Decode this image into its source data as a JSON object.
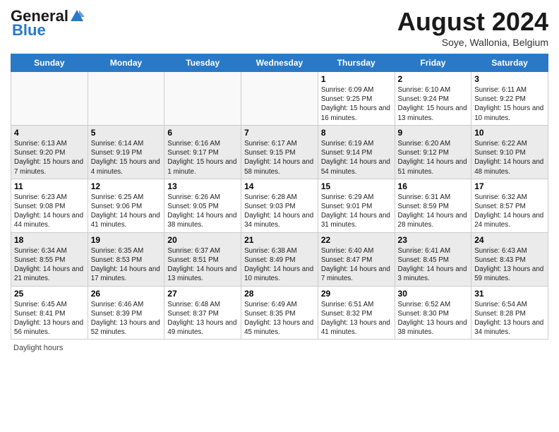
{
  "header": {
    "logo_general": "General",
    "logo_blue": "Blue",
    "month_title": "August 2024",
    "location": "Soye, Wallonia, Belgium"
  },
  "days_of_week": [
    "Sunday",
    "Monday",
    "Tuesday",
    "Wednesday",
    "Thursday",
    "Friday",
    "Saturday"
  ],
  "footer": {
    "daylight_label": "Daylight hours"
  },
  "weeks": [
    {
      "row_class": "row-odd",
      "days": [
        {
          "number": "",
          "info": ""
        },
        {
          "number": "",
          "info": ""
        },
        {
          "number": "",
          "info": ""
        },
        {
          "number": "",
          "info": ""
        },
        {
          "number": "1",
          "info": "Sunrise: 6:09 AM\nSunset: 9:25 PM\nDaylight: 15 hours and 16 minutes."
        },
        {
          "number": "2",
          "info": "Sunrise: 6:10 AM\nSunset: 9:24 PM\nDaylight: 15 hours and 13 minutes."
        },
        {
          "number": "3",
          "info": "Sunrise: 6:11 AM\nSunset: 9:22 PM\nDaylight: 15 hours and 10 minutes."
        }
      ]
    },
    {
      "row_class": "row-even",
      "days": [
        {
          "number": "4",
          "info": "Sunrise: 6:13 AM\nSunset: 9:20 PM\nDaylight: 15 hours and 7 minutes."
        },
        {
          "number": "5",
          "info": "Sunrise: 6:14 AM\nSunset: 9:19 PM\nDaylight: 15 hours and 4 minutes."
        },
        {
          "number": "6",
          "info": "Sunrise: 6:16 AM\nSunset: 9:17 PM\nDaylight: 15 hours and 1 minute."
        },
        {
          "number": "7",
          "info": "Sunrise: 6:17 AM\nSunset: 9:15 PM\nDaylight: 14 hours and 58 minutes."
        },
        {
          "number": "8",
          "info": "Sunrise: 6:19 AM\nSunset: 9:14 PM\nDaylight: 14 hours and 54 minutes."
        },
        {
          "number": "9",
          "info": "Sunrise: 6:20 AM\nSunset: 9:12 PM\nDaylight: 14 hours and 51 minutes."
        },
        {
          "number": "10",
          "info": "Sunrise: 6:22 AM\nSunset: 9:10 PM\nDaylight: 14 hours and 48 minutes."
        }
      ]
    },
    {
      "row_class": "row-odd",
      "days": [
        {
          "number": "11",
          "info": "Sunrise: 6:23 AM\nSunset: 9:08 PM\nDaylight: 14 hours and 44 minutes."
        },
        {
          "number": "12",
          "info": "Sunrise: 6:25 AM\nSunset: 9:06 PM\nDaylight: 14 hours and 41 minutes."
        },
        {
          "number": "13",
          "info": "Sunrise: 6:26 AM\nSunset: 9:05 PM\nDaylight: 14 hours and 38 minutes."
        },
        {
          "number": "14",
          "info": "Sunrise: 6:28 AM\nSunset: 9:03 PM\nDaylight: 14 hours and 34 minutes."
        },
        {
          "number": "15",
          "info": "Sunrise: 6:29 AM\nSunset: 9:01 PM\nDaylight: 14 hours and 31 minutes."
        },
        {
          "number": "16",
          "info": "Sunrise: 6:31 AM\nSunset: 8:59 PM\nDaylight: 14 hours and 28 minutes."
        },
        {
          "number": "17",
          "info": "Sunrise: 6:32 AM\nSunset: 8:57 PM\nDaylight: 14 hours and 24 minutes."
        }
      ]
    },
    {
      "row_class": "row-even",
      "days": [
        {
          "number": "18",
          "info": "Sunrise: 6:34 AM\nSunset: 8:55 PM\nDaylight: 14 hours and 21 minutes."
        },
        {
          "number": "19",
          "info": "Sunrise: 6:35 AM\nSunset: 8:53 PM\nDaylight: 14 hours and 17 minutes."
        },
        {
          "number": "20",
          "info": "Sunrise: 6:37 AM\nSunset: 8:51 PM\nDaylight: 14 hours and 13 minutes."
        },
        {
          "number": "21",
          "info": "Sunrise: 6:38 AM\nSunset: 8:49 PM\nDaylight: 14 hours and 10 minutes."
        },
        {
          "number": "22",
          "info": "Sunrise: 6:40 AM\nSunset: 8:47 PM\nDaylight: 14 hours and 7 minutes."
        },
        {
          "number": "23",
          "info": "Sunrise: 6:41 AM\nSunset: 8:45 PM\nDaylight: 14 hours and 3 minutes."
        },
        {
          "number": "24",
          "info": "Sunrise: 6:43 AM\nSunset: 8:43 PM\nDaylight: 13 hours and 59 minutes."
        }
      ]
    },
    {
      "row_class": "row-odd",
      "days": [
        {
          "number": "25",
          "info": "Sunrise: 6:45 AM\nSunset: 8:41 PM\nDaylight: 13 hours and 56 minutes."
        },
        {
          "number": "26",
          "info": "Sunrise: 6:46 AM\nSunset: 8:39 PM\nDaylight: 13 hours and 52 minutes."
        },
        {
          "number": "27",
          "info": "Sunrise: 6:48 AM\nSunset: 8:37 PM\nDaylight: 13 hours and 49 minutes."
        },
        {
          "number": "28",
          "info": "Sunrise: 6:49 AM\nSunset: 8:35 PM\nDaylight: 13 hours and 45 minutes."
        },
        {
          "number": "29",
          "info": "Sunrise: 6:51 AM\nSunset: 8:32 PM\nDaylight: 13 hours and 41 minutes."
        },
        {
          "number": "30",
          "info": "Sunrise: 6:52 AM\nSunset: 8:30 PM\nDaylight: 13 hours and 38 minutes."
        },
        {
          "number": "31",
          "info": "Sunrise: 6:54 AM\nSunset: 8:28 PM\nDaylight: 13 hours and 34 minutes."
        }
      ]
    }
  ]
}
